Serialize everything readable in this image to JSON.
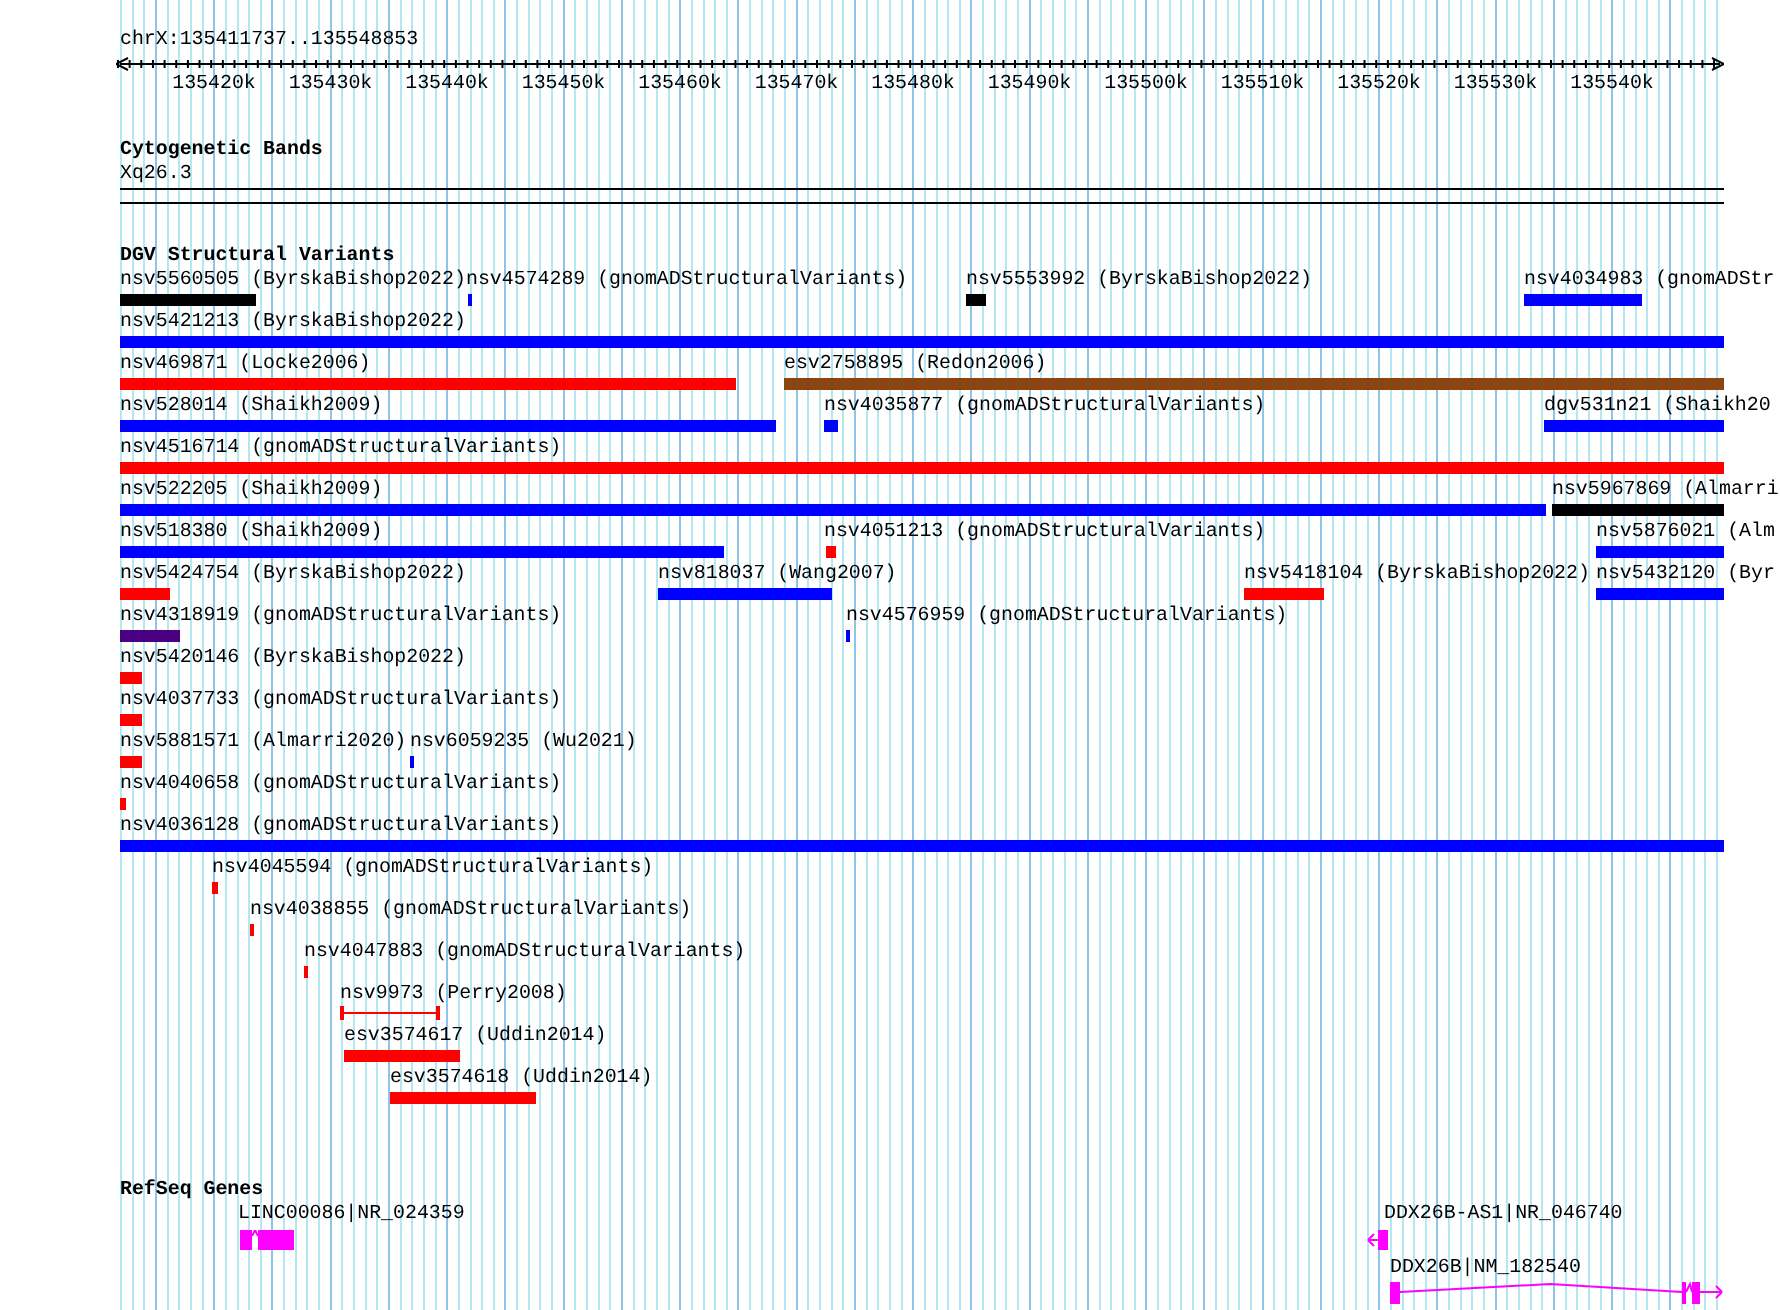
{
  "location": "chrX:135411737..135548853",
  "ruler": {
    "ticks": [
      "135420k",
      "135430k",
      "135440k",
      "135450k",
      "135460k",
      "135470k",
      "135480k",
      "135490k",
      "135500k",
      "135510k",
      "135520k",
      "135530k",
      "135540k"
    ]
  },
  "cytogenetic_bands": {
    "title": "Cytogenetic Bands",
    "band": "Xq26.3"
  },
  "dgv": {
    "title": "DGV Structural Variants",
    "rows": [
      {
        "features": [
          {
            "label": "nsv5560505 (ByrskaBishop2022)",
            "color": "#000000",
            "kind": "bar"
          },
          {
            "label": "nsv4574289 (gnomADStructuralVariants)",
            "color": "#0000ff",
            "kind": "bar"
          },
          {
            "label": "nsv5553992 (ByrskaBishop2022)",
            "color": "#000000",
            "kind": "bar"
          },
          {
            "label": "nsv4034983 (gnomADStr",
            "color": "#0000ff",
            "kind": "bar"
          }
        ]
      },
      {
        "features": [
          {
            "label": "nsv5421213 (ByrskaBishop2022)",
            "color": "#0000ff",
            "kind": "bar"
          }
        ]
      },
      {
        "features": [
          {
            "label": "nsv469871 (Locke2006)",
            "color": "#ff0000",
            "kind": "bar"
          },
          {
            "label": "esv2758895 (Redon2006)",
            "color": "#8b4513",
            "kind": "bar"
          }
        ]
      },
      {
        "features": [
          {
            "label": "nsv528014 (Shaikh2009)",
            "color": "#0000ff",
            "kind": "bar"
          },
          {
            "label": "nsv4035877 (gnomADStructuralVariants)",
            "color": "#0000ff",
            "kind": "bar"
          },
          {
            "label": "dgv531n21 (Shaikh20",
            "color": "#0000ff",
            "kind": "bar"
          }
        ]
      },
      {
        "features": [
          {
            "label": "nsv4516714 (gnomADStructuralVariants)",
            "color": "#ff0000",
            "kind": "bar"
          }
        ]
      },
      {
        "features": [
          {
            "label": "nsv522205 (Shaikh2009)",
            "color": "#0000ff",
            "kind": "bar"
          },
          {
            "label": "nsv5967869 (Almarri",
            "color": "#000000",
            "kind": "bar"
          }
        ]
      },
      {
        "features": [
          {
            "label": "nsv518380 (Shaikh2009)",
            "color": "#0000ff",
            "kind": "bar"
          },
          {
            "label": "nsv4051213 (gnomADStructuralVariants)",
            "color": "#ff0000",
            "kind": "bar"
          },
          {
            "label": "nsv5876021 (Alm",
            "color": "#0000ff",
            "kind": "bar"
          }
        ]
      },
      {
        "features": [
          {
            "label": "nsv5424754 (ByrskaBishop2022)",
            "color": "#ff0000",
            "kind": "bar"
          },
          {
            "label": "nsv818037 (Wang2007)",
            "color": "#0000ff",
            "kind": "bar"
          },
          {
            "label": "nsv5418104 (ByrskaBishop2022)",
            "color": "#ff0000",
            "kind": "bar"
          },
          {
            "label": "nsv5432120 (Byr",
            "color": "#0000ff",
            "kind": "bar"
          }
        ]
      },
      {
        "features": [
          {
            "label": "nsv4318919 (gnomADStructuralVariants)",
            "color": "#4b0082",
            "kind": "bar"
          },
          {
            "label": "nsv4576959 (gnomADStructuralVariants)",
            "color": "#0000ff",
            "kind": "bar"
          }
        ]
      },
      {
        "features": [
          {
            "label": "nsv5420146 (ByrskaBishop2022)",
            "color": "#ff0000",
            "kind": "bar"
          }
        ]
      },
      {
        "features": [
          {
            "label": "nsv4037733 (gnomADStructuralVariants)",
            "color": "#ff0000",
            "kind": "bar"
          }
        ]
      },
      {
        "features": [
          {
            "label": "nsv5881571 (Almarri2020)",
            "color": "#ff0000",
            "kind": "bar"
          },
          {
            "label": "nsv6059235 (Wu2021)",
            "color": "#0000ff",
            "kind": "bar"
          }
        ]
      },
      {
        "features": [
          {
            "label": "nsv4040658 (gnomADStructuralVariants)",
            "color": "#ff0000",
            "kind": "bar"
          }
        ]
      },
      {
        "features": [
          {
            "label": "nsv4036128 (gnomADStructuralVariants)",
            "color": "#0000ff",
            "kind": "bar"
          }
        ]
      },
      {
        "features": [
          {
            "label": "nsv4045594 (gnomADStructuralVariants)",
            "color": "#ff0000",
            "kind": "bar"
          }
        ]
      },
      {
        "features": [
          {
            "label": "nsv4038855 (gnomADStructuralVariants)",
            "color": "#ff0000",
            "kind": "bar"
          }
        ]
      },
      {
        "features": [
          {
            "label": "nsv4047883 (gnomADStructuralVariants)",
            "color": "#ff0000",
            "kind": "bar"
          }
        ]
      },
      {
        "features": [
          {
            "label": "nsv9973 (Perry2008)",
            "color": "#ff0000",
            "kind": "span"
          }
        ]
      },
      {
        "features": [
          {
            "label": "esv3574617 (Uddin2014)",
            "color": "#ff0000",
            "kind": "bar"
          }
        ]
      },
      {
        "features": [
          {
            "label": "esv3574618 (Uddin2014)",
            "color": "#ff0000",
            "kind": "bar"
          }
        ]
      }
    ]
  },
  "refseq": {
    "title": "RefSeq Genes",
    "genes": [
      {
        "label": "LINC00086|NR_024359"
      },
      {
        "label": "DDX26B-AS1|NR_046740"
      },
      {
        "label": "DDX26B|NM_182540"
      }
    ]
  }
}
